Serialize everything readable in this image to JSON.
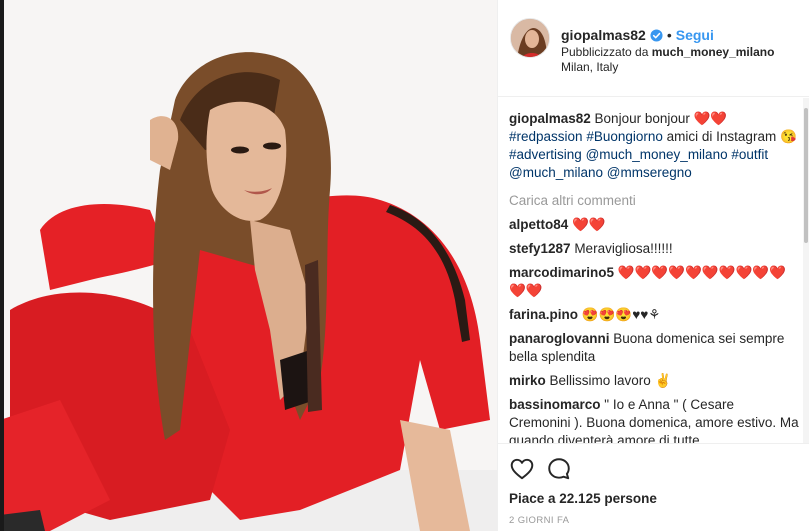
{
  "post": {
    "author": "giopalmas82",
    "follow_label": "Segui",
    "dot": "•",
    "sponsored_label": "Pubblicizzato da ",
    "sponsor": "much_money_milano",
    "location": "Milan, Italy"
  },
  "caption": {
    "user": "giopalmas82",
    "text_1": " Bonjour bonjour ❤️❤️ ",
    "tag_1": "#redpassion",
    "space_1": " ",
    "tag_2": "#Buongiorno",
    "text_2": " amici di Instagram 😘 ",
    "tag_3": "#advertising",
    "space_2": " ",
    "tag_4": "@much_money_milano",
    "space_3": " ",
    "tag_5": "#outfit",
    "space_4": " ",
    "tag_6": "@much_milano",
    "space_5": " ",
    "tag_7": "@mmseregno"
  },
  "load_more_label": "Carica altri commenti",
  "comments": [
    {
      "user": "alpetto84",
      "text": " ❤️❤️"
    },
    {
      "user": "stefy1287",
      "text": " Meravigliosa!!!!!!"
    },
    {
      "user": "marcodimarino5",
      "text": " ❤️❤️❤️❤️❤️❤️❤️❤️❤️❤️❤️❤️"
    },
    {
      "user": "farina.pino",
      "text": " 😍😍😍♥♥⚘"
    },
    {
      "user": "panaroglovanni",
      "text": " Buona domenica sei sempre bella splendita"
    },
    {
      "user": "mirko",
      "text": " Bellissimo lavoro ✌"
    },
    {
      "user": "bassinomarco",
      "text": " \" Io e Anna \" ( Cesare Cremonini ). Buona domenica, amore estivo. Ma quando diventerà amore di tutte"
    }
  ],
  "likes_label": "Piace a 22.125 persone",
  "time_label": "2 GIORNI FA",
  "colors": {
    "link": "#3897f0",
    "hashtag": "#003569",
    "muted": "#999999",
    "suit_red": "#e8252b"
  },
  "icons": {
    "verified": "verified-badge-icon",
    "like": "heart-icon",
    "comment": "comment-bubble-icon"
  }
}
